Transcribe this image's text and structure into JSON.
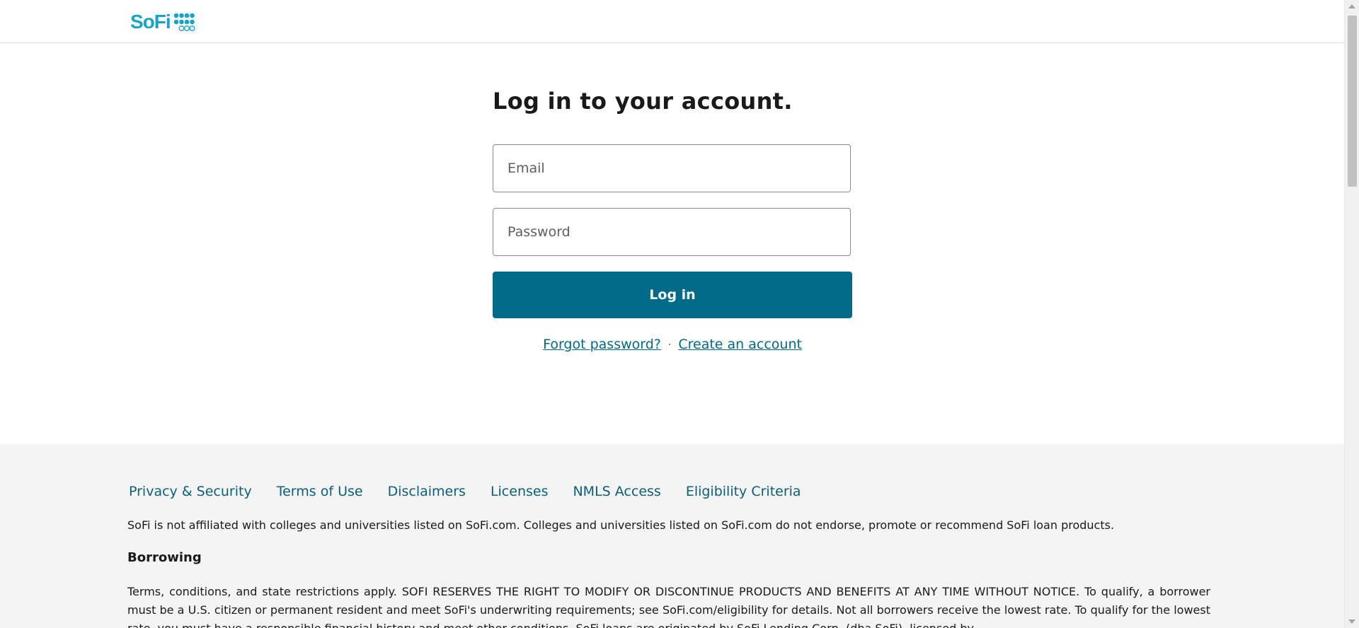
{
  "header": {
    "logo_text": "SoFi",
    "logo_icon": "sofi-dots-icon",
    "brand_color": "#1ba3c6"
  },
  "login": {
    "title": "Log in to your account.",
    "email_placeholder": "Email",
    "password_placeholder": "Password",
    "submit_label": "Log in",
    "forgot_label": "Forgot password?",
    "separator": "·",
    "create_label": "Create an account",
    "button_color": "#006a87"
  },
  "footer": {
    "nav": [
      "Privacy & Security",
      "Terms of Use",
      "Disclaimers",
      "Licenses",
      "NMLS Access",
      "Eligibility Criteria"
    ],
    "disclaimer": "SoFi is not affiliated with colleges and universities listed on SoFi.com. Colleges and universities listed on SoFi.com do not endorse, promote or recommend SoFi loan products.",
    "borrowing_heading": "Borrowing",
    "borrowing_text": "Terms, conditions, and state restrictions apply. SOFI RESERVES THE RIGHT TO MODIFY OR DISCONTINUE PRODUCTS AND BENEFITS AT ANY TIME WITHOUT NOTICE. To qualify, a borrower must be a U.S. citizen or permanent resident and meet SoFi's underwriting requirements; see SoFi.com/eligibility for details. Not all borrowers receive the lowest rate. To qualify for the lowest rate, you must have a responsible financial history and meet other conditions. SoFi loans are originated by SoFi Lending Corp. (dba SoFi), licensed by",
    "background": "#f4f4f4"
  }
}
